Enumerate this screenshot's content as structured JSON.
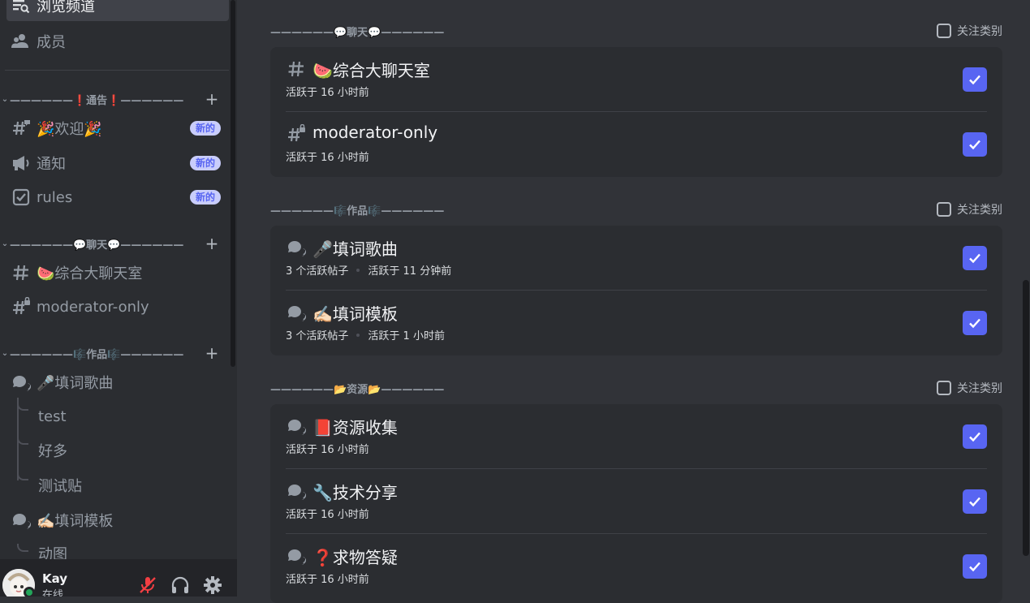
{
  "sidebar": {
    "browse_channels": "浏览频道",
    "members": "成员",
    "categories": [
      {
        "name": "——————❗️通告❗️——————"
      },
      {
        "name": "——————💬聊天💬——————"
      },
      {
        "name": "——————🎼作品🎼——————"
      }
    ],
    "announce_channels": [
      {
        "label": "🎉欢迎🎉",
        "badge": "新的"
      },
      {
        "label": "通知",
        "badge": "新的"
      },
      {
        "label": "rules",
        "badge": "新的"
      }
    ],
    "chat_channels": [
      {
        "label": "🍉综合大聊天室"
      },
      {
        "label": "moderator-only"
      }
    ],
    "works_channels": [
      {
        "label": "🎤填词歌曲"
      },
      {
        "label": "✍🏻填词模板"
      }
    ],
    "threads_song": [
      {
        "label": "test"
      },
      {
        "label": "好多"
      },
      {
        "label": "测试贴"
      }
    ],
    "threads_template": [
      {
        "label": "动图"
      }
    ]
  },
  "user": {
    "name": "Kay",
    "status": "在线"
  },
  "main": {
    "follow_label": "关注类别",
    "categories": [
      {
        "name": "——————💬聊天💬——————",
        "channels": [
          {
            "name": "🍉综合大聊天室",
            "activity": "活跃于 16 小时前",
            "icon": "hash-icon",
            "checked": true
          },
          {
            "name": "moderator-only",
            "activity": "活跃于 16 小时前",
            "icon": "hash-lock-icon",
            "checked": true
          }
        ]
      },
      {
        "name": "——————🎼作品🎼——————",
        "channels": [
          {
            "name": "🎤填词歌曲",
            "posts": "3 个活跃帖子",
            "activity": "活跃于 11 分钟前",
            "icon": "forum-icon",
            "checked": true
          },
          {
            "name": "✍🏻填词模板",
            "posts": "3 个活跃帖子",
            "activity": "活跃于 1 小时前",
            "icon": "forum-icon",
            "checked": true
          }
        ]
      },
      {
        "name": "——————📂资源📂——————",
        "channels": [
          {
            "name": "📕资源收集",
            "activity": "活跃于 16 小时前",
            "icon": "forum-icon",
            "checked": true
          },
          {
            "name": "🔧技术分享",
            "activity": "活跃于 16 小时前",
            "icon": "forum-icon",
            "checked": true
          },
          {
            "name": "❓求物答疑",
            "activity": "活跃于 16 小时前",
            "icon": "forum-icon",
            "checked": true
          }
        ]
      }
    ]
  },
  "colors": {
    "accent": "#5865f2",
    "badge_bg": "#c9cdfb",
    "online": "#23a55a"
  }
}
